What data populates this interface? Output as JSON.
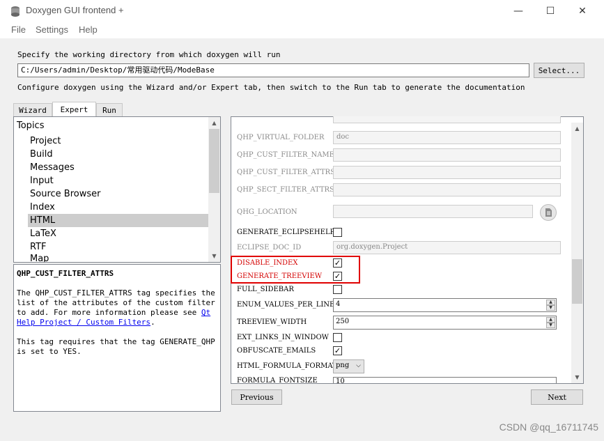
{
  "window": {
    "title": "Doxygen GUI frontend +",
    "minimize": "—",
    "maximize": "☐",
    "close": "✕"
  },
  "menu": [
    "File",
    "Settings",
    "Help"
  ],
  "instructions": {
    "working_dir": "Specify the working directory from which doxygen will run",
    "configure": "Configure doxygen using the Wizard and/or Expert tab, then switch to the Run tab to generate the documentation"
  },
  "working_dir_value": "C:/Users/admin/Desktop/常用驱动代码/ModeBase",
  "select_button": "Select...",
  "tabs": [
    {
      "label": "Wizard",
      "active": false
    },
    {
      "label": "Expert",
      "active": true
    },
    {
      "label": "Run",
      "active": false
    }
  ],
  "topics": {
    "header": "Topics",
    "items": [
      "Project",
      "Build",
      "Messages",
      "Input",
      "Source Browser",
      "Index",
      "HTML",
      "LaTeX",
      "RTF",
      "Map"
    ],
    "selected": "HTML"
  },
  "help": {
    "title": "QHP_CUST_FILTER_ATTRS",
    "body_1": "The QHP_CUST_FILTER_ATTRS tag specifies the list of the attributes of the custom filter to add. For more information please see",
    "link": "Qt Help Project / Custom Filters",
    "body_1_end": ".",
    "body_2": "This tag requires that the tag GENERATE_QHP is set to YES."
  },
  "settings": {
    "qhp_virtual_folder": {
      "label": "QHP_VIRTUAL_FOLDER",
      "value": "doc"
    },
    "qhp_cust_filter_name": {
      "label": "QHP_CUST_FILTER_NAME",
      "value": ""
    },
    "qhp_cust_filter_attrs": {
      "label": "QHP_CUST_FILTER_ATTRS",
      "value": ""
    },
    "qhp_sect_filter_attrs": {
      "label": "QHP_SECT_FILTER_ATTRS",
      "value": ""
    },
    "qhg_location": {
      "label": "QHG_LOCATION",
      "value": ""
    },
    "generate_eclipsehelp": {
      "label": "GENERATE_ECLIPSEHELP",
      "checked": false
    },
    "eclipse_doc_id": {
      "label": "ECLIPSE_DOC_ID",
      "value": "org.doxygen.Project"
    },
    "disable_index": {
      "label": "DISABLE_INDEX",
      "checked": true
    },
    "generate_treeview": {
      "label": "GENERATE_TREEVIEW",
      "checked": true
    },
    "full_sidebar": {
      "label": "FULL_SIDEBAR",
      "checked": false
    },
    "enum_values_per_line": {
      "label": "ENUM_VALUES_PER_LINE",
      "value": "4"
    },
    "treeview_width": {
      "label": "TREEVIEW_WIDTH",
      "value": "250"
    },
    "ext_links_in_window": {
      "label": "EXT_LINKS_IN_WINDOW",
      "checked": false
    },
    "obfuscate_emails": {
      "label": "OBFUSCATE_EMAILS",
      "checked": true
    },
    "html_formula_format": {
      "label": "HTML_FORMULA_FORMAT",
      "value": "png"
    },
    "formula_fontsize": {
      "label": "FORMULA_FONTSIZE",
      "value": "10"
    }
  },
  "nav": {
    "previous": "Previous",
    "next": "Next"
  },
  "watermark": "CSDN @qq_16711745",
  "colors": {
    "highlight": "#e00000",
    "disabled_label": "#8a8a8a",
    "red_label": "#d40000"
  }
}
